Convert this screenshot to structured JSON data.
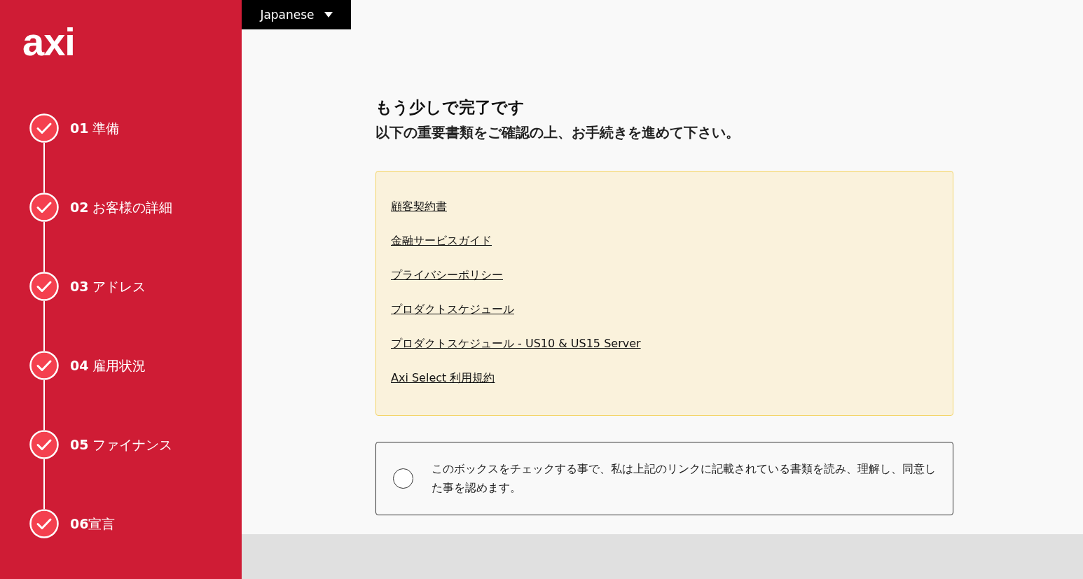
{
  "logo": "axi",
  "language": {
    "label": "Japanese"
  },
  "steps": [
    {
      "label": "**01** 準備",
      "completed": true
    },
    {
      "label": "**02** お客様の詳細",
      "completed": true
    },
    {
      "label": "**03** アドレス",
      "completed": true
    },
    {
      "label": "**04** 雇用状況",
      "completed": true
    },
    {
      "label": "**05** ファイナンス",
      "completed": true
    },
    {
      "label": "**06**宣言",
      "completed": true
    }
  ],
  "heading": "もう少しで完了です",
  "subheading": "以下の重要書類をご確認の上、お手続きを進めて下さい。",
  "documents": [
    "顧客契約書",
    "金融サービスガイド",
    "プライバシーポリシー",
    "プロダクトスケジュール",
    "プロダクトスケジュール - US10 & US15 Server",
    "Axi Select 利用規約"
  ],
  "agreement": {
    "checked": false,
    "text": "このボックスをチェックする事で、私は上記のリンクに記載されている書類を読み、理解し、同意した事を認めます。"
  }
}
